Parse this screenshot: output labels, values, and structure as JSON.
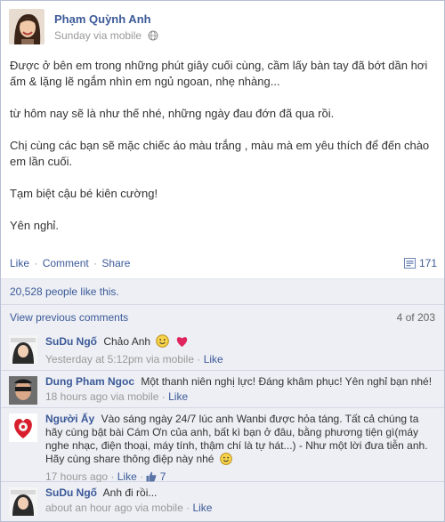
{
  "post": {
    "author": "Phạm Quỳnh Anh",
    "time": "Sunday via mobile",
    "paragraphs": [
      "Được ở bên em trong những phút giây cuối cùng, cầm lấy bàn tay đã bớt dần hơi ấm & lặng lẽ ngắm nhìn em ngủ ngoan, nhẹ nhàng...",
      "từ hôm nay sẽ là như thế nhé, những ngày đau đớn đã qua rồi.",
      "Chị cùng các bạn sẽ mặc chiếc áo màu trắng , màu mà em yêu thích để đến chào em lần cuối.",
      "Tạm biệt cậu bé kiên cường!",
      "Yên nghỉ."
    ]
  },
  "actions": {
    "like": "Like",
    "comment": "Comment",
    "share": "Share",
    "sep": "·",
    "share_count": "171"
  },
  "likes_text": "20,528 people like this.",
  "view_previous": "View previous comments",
  "comment_count": "4 of 203",
  "comments": [
    {
      "name": "SuDu Ngố",
      "text": "Chảo Anh",
      "meta": "Yesterday at 5:12pm via mobile",
      "like": "Like"
    },
    {
      "name": "Dung Pham Ngoc",
      "text": "Một thanh niên nghị lực! Đáng khâm phục! Yên nghỉ bạn nhé!",
      "meta": "18 hours ago via mobile",
      "like": "Like"
    },
    {
      "name": "Người Ấy",
      "text": "Vào sáng ngày 24/7 lúc anh Wanbi được hỏa táng. Tất cả chúng ta hãy cùng bật bài Cám Ơn của anh, bất kì bạn ở đâu, bằng phương tiện gì(máy nghe nhạc, điện thoại, máy tính, thậm chí là tự hát...) - Như một lời đưa tiễn anh. Hãy cùng share thông điệp này nhé",
      "meta": "17 hours ago",
      "like": "Like",
      "like_count": "7"
    },
    {
      "name": "SuDu Ngố",
      "text": "Anh đi rồi...",
      "meta": "about an hour ago via mobile",
      "like": "Like"
    }
  ],
  "colors": {
    "link": "#3b5998",
    "ufi_bg": "#edeff4",
    "meta": "#999999",
    "heart": "#e0245e"
  },
  "icons": [
    "globe-icon",
    "share-icon",
    "thumbs-up-icon",
    "smiley-icon",
    "heart-icon"
  ]
}
